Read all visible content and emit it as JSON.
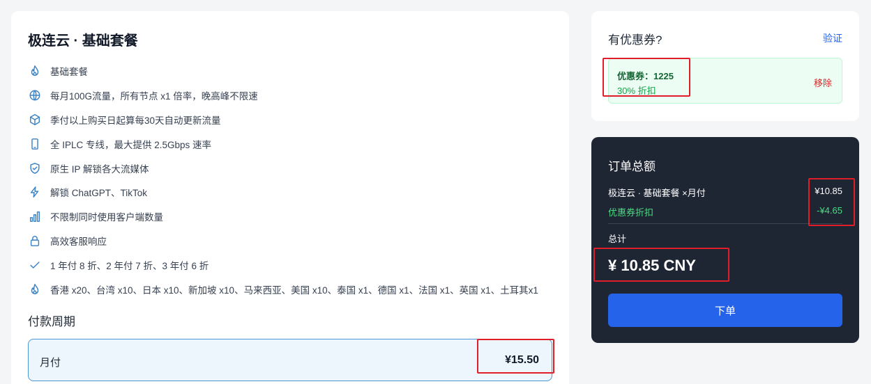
{
  "plan": {
    "title": "极连云 · 基础套餐",
    "features": [
      {
        "icon": "flame-icon",
        "text": "基础套餐"
      },
      {
        "icon": "globe-icon",
        "text": "每月100G流量，所有节点 x1 倍率，晚高峰不限速"
      },
      {
        "icon": "cube-icon",
        "text": "季付以上购买日起算每30天自动更新流量"
      },
      {
        "icon": "phone-icon",
        "text": "全 IPLC 专线，最大提供 2.5Gbps 速率"
      },
      {
        "icon": "shield-check-icon",
        "text": "原生 IP 解锁各大流媒体"
      },
      {
        "icon": "lightning-icon",
        "text": "解锁 ChatGPT、TikTok"
      },
      {
        "icon": "signal-bars-icon",
        "text": "不限制同时使用客户端数量"
      },
      {
        "icon": "lock-icon",
        "text": "高效客服响应"
      },
      {
        "icon": "check-icon",
        "text": "1 年付 8 折、2 年付 7 折、3 年付 6 折"
      },
      {
        "icon": "flame-icon",
        "text": "香港 x20、台湾 x10、日本 x10、新加坡 x10、马来西亚、美国 x10、泰国 x1、德国 x1、法国 x1、英国 x1、土耳其x1"
      }
    ]
  },
  "period": {
    "title": "付款周期",
    "option": {
      "name": "月付",
      "price": "¥15.50"
    }
  },
  "coupon": {
    "title": "有优惠券?",
    "verify_label": "验证",
    "code_text": "优惠券：1225",
    "discount_text": "30% 折扣",
    "remove_label": "移除"
  },
  "order": {
    "title": "订单总额",
    "plan_line": {
      "label": "极连云 · 基础套餐 ×月付",
      "amount": "¥10.85"
    },
    "coupon_line": {
      "label": "优惠券折扣",
      "amount": "-¥4.65"
    },
    "total_label": "总计",
    "total_value": "¥ 10.85 CNY",
    "submit_label": "下单"
  },
  "colors": {
    "accent": "#2563eb",
    "annotation": "#e11d2a",
    "success": "#16a34a",
    "danger": "#dc2626",
    "dark_panel": "#1e2533"
  }
}
